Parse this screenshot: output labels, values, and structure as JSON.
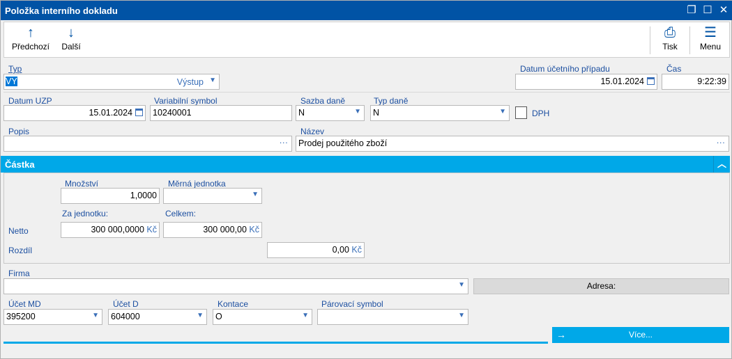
{
  "window": {
    "title": "Položka interního dokladu"
  },
  "toolbar": {
    "prev": "Předchozí",
    "next": "Další",
    "print": "Tisk",
    "menu": "Menu"
  },
  "form": {
    "typ": {
      "label": "Typ",
      "value": "VY",
      "desc": "Výstup"
    },
    "datum_pripadu": {
      "label": "Datum účetního případu",
      "value": "15.01.2024"
    },
    "cas": {
      "label": "Čas",
      "value": "9:22:39"
    },
    "datum_uzp": {
      "label": "Datum UZP",
      "value": "15.01.2024"
    },
    "var_symbol": {
      "label": "Variabilní symbol",
      "value": "10240001"
    },
    "sazba_dane": {
      "label": "Sazba daně",
      "value": "N"
    },
    "typ_dane": {
      "label": "Typ daně",
      "value": "N"
    },
    "dph": {
      "label": "DPH",
      "checked": false
    },
    "popis": {
      "label": "Popis",
      "value": ""
    },
    "nazev": {
      "label": "Název",
      "value": "Prodej použitého zboží"
    }
  },
  "castka": {
    "title": "Částka",
    "mnozstvi": {
      "label": "Množství",
      "value": "1,0000"
    },
    "jednotka": {
      "label": "Měrná jednotka",
      "value": ""
    },
    "za_jednotku": {
      "label": "Za jednotku:",
      "value": "300 000,0000",
      "currency": "Kč"
    },
    "celkem": {
      "label": "Celkem:",
      "value": "300 000,00",
      "currency": "Kč"
    },
    "netto": "Netto",
    "rozdil": {
      "label": "Rozdíl",
      "value": "0,00",
      "currency": "Kč"
    }
  },
  "firma": {
    "label": "Firma",
    "value": "",
    "adresa": "Adresa:"
  },
  "ucty": {
    "md": {
      "label": "Účet MD",
      "value": "395200"
    },
    "d": {
      "label": "Účet D",
      "value": "604000"
    },
    "kontace": {
      "label": "Kontace",
      "value": "O"
    },
    "parovaci": {
      "label": "Párovací symbol",
      "value": ""
    }
  },
  "more": "Více..."
}
